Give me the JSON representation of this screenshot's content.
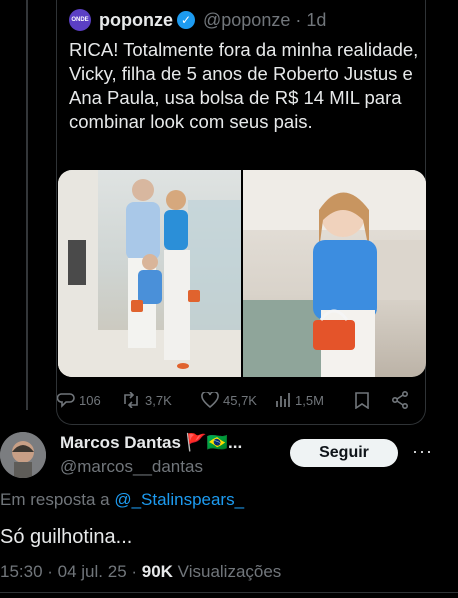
{
  "quoted_tweet": {
    "avatar_text": "ONDE",
    "name": "poponze",
    "handle_time": "@poponze · 1d",
    "text": "RICA! Totalmente fora da minha realidade, Vicky, filha de 5 anos de Roberto Justus e Ana Paula, usa bolsa de R$ 14 MIL para combinar look com seus pais.",
    "stats": {
      "replies": "106",
      "reposts": "3,7K",
      "likes": "45,7K",
      "views": "1,5M"
    }
  },
  "tweet": {
    "author_name": "Marcos Dantas",
    "author_flags": "🚩🇧🇷...",
    "handle": "@marcos__dantas",
    "follow_label": "Seguir",
    "more_label": "···",
    "reply_prefix": "Em resposta a ",
    "reply_handle": "@_Stalinspears_",
    "text": "Só guilhotina...",
    "timestamp": "15:30 · 04 jul. 25 · ",
    "views_count": "90K",
    "views_label": " Visualizações"
  },
  "colors": {
    "accent": "#1d9bf0",
    "bg": "#000000",
    "muted": "#71767b"
  },
  "icons": [
    "reply-icon",
    "repost-icon",
    "like-icon",
    "views-icon",
    "bookmark-icon",
    "share-icon",
    "verified-icon"
  ]
}
